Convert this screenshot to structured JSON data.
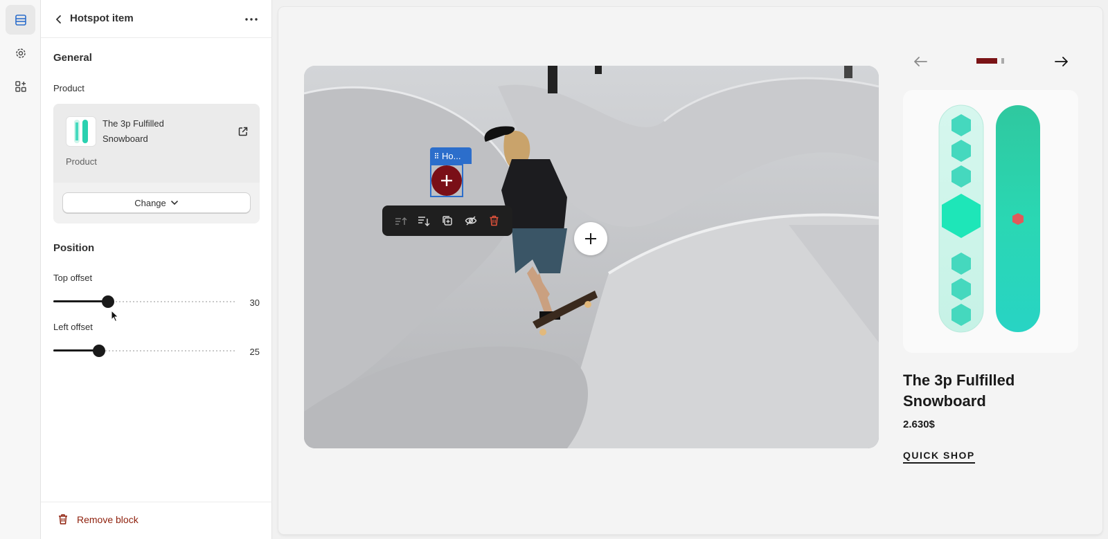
{
  "panel": {
    "title": "Hotspot item",
    "general_title": "General",
    "product_label": "Product",
    "product": {
      "name": "The 3p Fulfilled Snowboard",
      "type": "Product"
    },
    "change_button": "Change",
    "position_title": "Position",
    "top_offset": {
      "label": "Top offset",
      "value": 30
    },
    "left_offset": {
      "label": "Left offset",
      "value": 25
    },
    "remove_button": "Remove block"
  },
  "rail": {
    "items": [
      "sections-icon",
      "settings-icon",
      "apps-icon"
    ],
    "active": "sections-icon"
  },
  "preview": {
    "hotspot_label": "Ho...",
    "toolbar_tools": [
      "move-up-icon",
      "move-down-icon",
      "duplicate-icon",
      "hide-icon",
      "delete-icon"
    ],
    "slider_pages": 2,
    "current_page": 1,
    "product_title": "The 3p Fulfilled Snowboard",
    "product_price": "2.630$",
    "quick_shop": "QUICK SHOP"
  },
  "colors": {
    "accent_blue": "#2c6ecb",
    "hotspot_red": "#7a0f17",
    "danger": "#8e1f0b",
    "delete_icon": "#e5533c"
  }
}
